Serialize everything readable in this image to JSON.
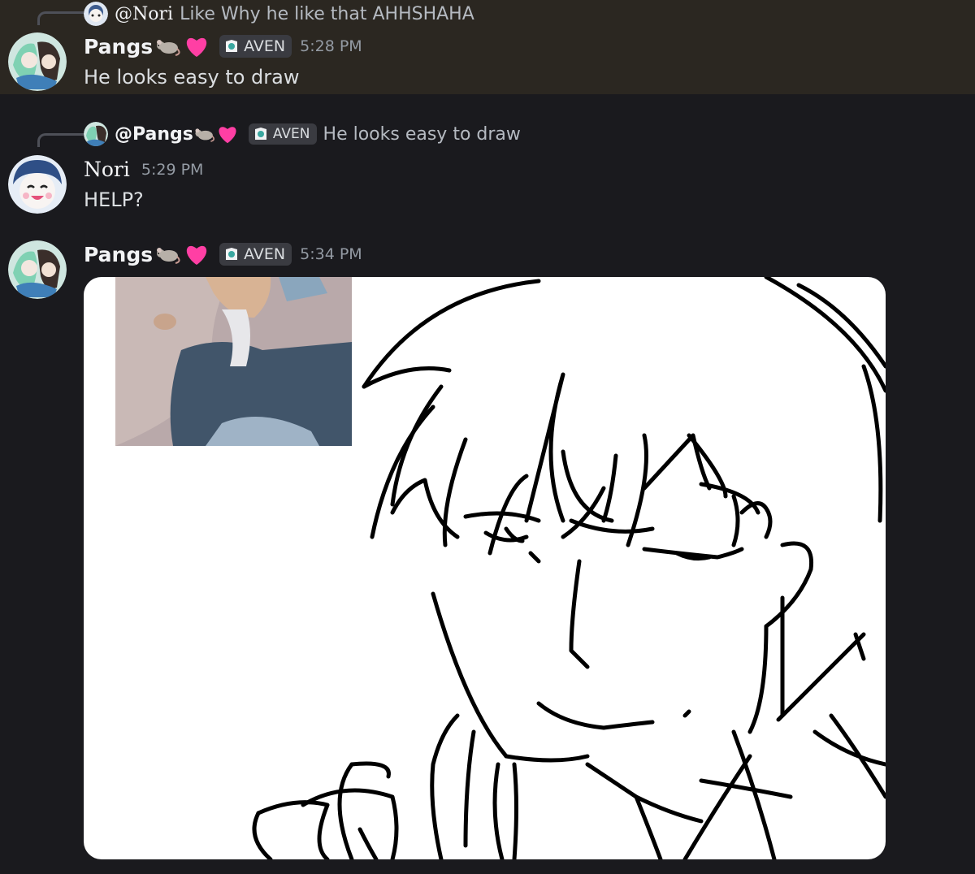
{
  "messages": [
    {
      "reply": {
        "user": "@Nori",
        "text": "Like Why he like that AHHSHAHA"
      },
      "author": "Pangs",
      "author_emoji": [
        "rat-emoji",
        "pink-heart-emoji"
      ],
      "role_tag": "AVEN",
      "time": "5:28 PM",
      "text": "He looks easy to draw",
      "highlighted": true
    },
    {
      "reply": {
        "user": "@Pangs",
        "role_tag": "AVEN",
        "text": "He looks easy to draw"
      },
      "author": "Nori",
      "time": "5:29 PM",
      "text": "HELP?"
    },
    {
      "author": "Pangs",
      "role_tag": "AVEN",
      "time": "5:34 PM",
      "attachment": {
        "type": "image",
        "content": "line sketch of anime character next to reference photo of figure"
      }
    }
  ],
  "colors": {
    "background": "#1a1a1e",
    "highlight": "#2b2721",
    "tag_bg": "#3a3b41",
    "timestamp": "#949ba4",
    "heart": "#ff3fa4"
  }
}
